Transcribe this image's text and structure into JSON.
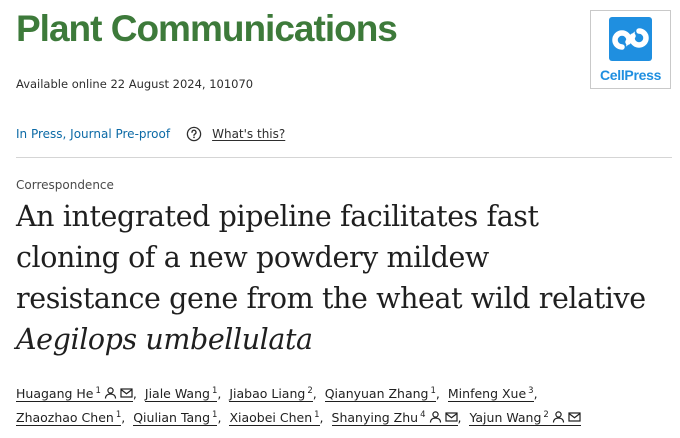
{
  "journal": {
    "title": "Plant Communications",
    "availability": "Available online 22 August 2024, 101070"
  },
  "publisher_logo": {
    "label": "CellPress",
    "icon": "cellpress-logo-icon",
    "color": "#1f8fe0"
  },
  "status": {
    "link_text": "In Press, Journal Pre-proof",
    "help_icon": "question-circle-icon",
    "whats_this": "What's this?"
  },
  "article": {
    "type": "Correspondence",
    "title_lines": [
      "An integrated pipeline facilitates fast",
      "cloning of a new powdery mildew",
      "resistance gene from the wheat wild relative"
    ],
    "title_italic": "Aegilops umbellulata"
  },
  "authors": [
    {
      "name": "Huagang He",
      "sup": "1",
      "person_icon": true,
      "email_icon": true
    },
    {
      "name": "Jiale Wang",
      "sup": "1",
      "person_icon": false,
      "email_icon": false
    },
    {
      "name": "Jiabao Liang",
      "sup": "2",
      "person_icon": false,
      "email_icon": false
    },
    {
      "name": "Qianyuan Zhang",
      "sup": "1",
      "person_icon": false,
      "email_icon": false
    },
    {
      "name": "Minfeng Xue",
      "sup": "3",
      "person_icon": false,
      "email_icon": false
    },
    {
      "name": "Zhaozhao Chen",
      "sup": "1",
      "person_icon": false,
      "email_icon": false
    },
    {
      "name": "Qiulian Tang",
      "sup": "1",
      "person_icon": false,
      "email_icon": false
    },
    {
      "name": "Xiaobei Chen",
      "sup": "1",
      "person_icon": false,
      "email_icon": false
    },
    {
      "name": "Shanying Zhu",
      "sup": "4",
      "person_icon": true,
      "email_icon": true
    },
    {
      "name": "Yajun Wang",
      "sup": "2",
      "person_icon": true,
      "email_icon": true
    }
  ],
  "colors": {
    "journal_green": "#3d7a3a",
    "link_blue": "#0c6aa6",
    "text": "#1f1f1f"
  }
}
